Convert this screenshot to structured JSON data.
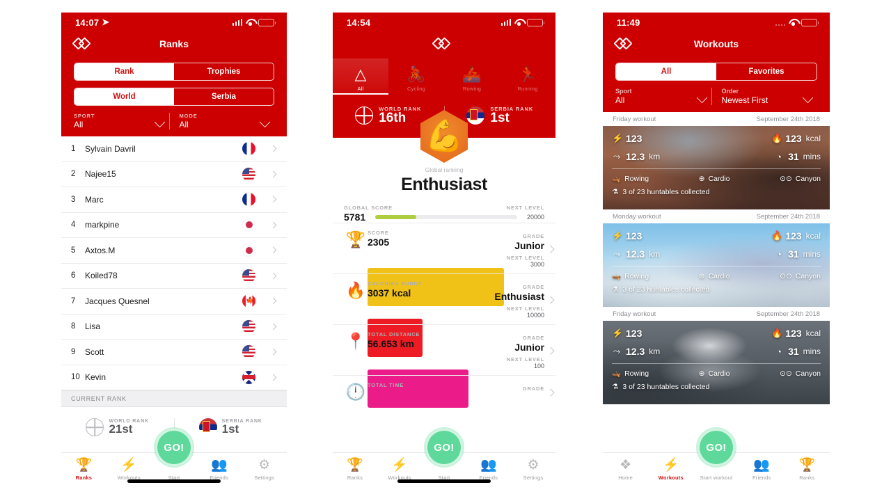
{
  "colors": {
    "brand_red": "#cc0000",
    "accent_red": "#d81111",
    "go_green": "#5fd99b",
    "score_green": "#aece3f",
    "trophy_yellow": "#f0c117",
    "calories_red": "#ed1c24",
    "distance_pink": "#ec1b8a",
    "time_orange": "#f07c1c"
  },
  "screen1": {
    "status": {
      "time": "14:07",
      "location_arrow": "➤",
      "battery": "green"
    },
    "header": {
      "logo": "app-logo",
      "title": "Ranks"
    },
    "segment_type": {
      "options": [
        "Rank",
        "Trophies"
      ],
      "selected": "Rank"
    },
    "segment_scope": {
      "options": [
        "World",
        "Serbia"
      ],
      "selected": "World"
    },
    "filters": [
      {
        "label": "SPORT",
        "value": "All"
      },
      {
        "label": "MODE",
        "value": "All"
      }
    ],
    "rank_rows": [
      {
        "pos": "1",
        "name": "Sylvain Davril",
        "flag": "fr"
      },
      {
        "pos": "2",
        "name": "Najee15",
        "flag": "us"
      },
      {
        "pos": "3",
        "name": "Marc",
        "flag": "fr"
      },
      {
        "pos": "4",
        "name": "markpine",
        "flag": "jp"
      },
      {
        "pos": "5",
        "name": "Axtos.M",
        "flag": "jp"
      },
      {
        "pos": "6",
        "name": "Koiled78",
        "flag": "us"
      },
      {
        "pos": "7",
        "name": "Jacques Quesnel",
        "flag": "ca"
      },
      {
        "pos": "8",
        "name": "Lisa",
        "flag": "us"
      },
      {
        "pos": "9",
        "name": "Scott",
        "flag": "us"
      },
      {
        "pos": "10",
        "name": "Kevin",
        "flag": "gb"
      }
    ],
    "current_rank_header": "CURRENT RANK",
    "current_rank": [
      {
        "label": "WORLD RANK",
        "value": "21st",
        "icon": "globe-icon"
      },
      {
        "label": "SERBIA RANK",
        "value": "1st",
        "icon": "serbia-flag-icon"
      }
    ],
    "tabs": [
      {
        "label": "Ranks",
        "icon": "trophy-icon",
        "active": true
      },
      {
        "label": "Workouts",
        "icon": "bolt-circle-icon",
        "active": false
      },
      {
        "label": "Start",
        "icon": "go-icon",
        "active": false
      },
      {
        "label": "Friends",
        "icon": "friends-icon",
        "active": false
      },
      {
        "label": "Settings",
        "icon": "gear-icon",
        "active": false
      }
    ],
    "go_label": "GO!"
  },
  "screen2": {
    "status": {
      "time": "14:54",
      "battery": "white"
    },
    "header": {
      "logo": "app-logo"
    },
    "sports": [
      {
        "label": "All",
        "icon": "all-sports-icon",
        "active": true
      },
      {
        "label": "Cycling",
        "icon": "cycling-icon",
        "active": false
      },
      {
        "label": "Rowing",
        "icon": "rowing-icon",
        "active": false
      },
      {
        "label": "Running",
        "icon": "running-icon",
        "active": false
      }
    ],
    "ranks": [
      {
        "label": "WORLD RANK",
        "value": "16th",
        "icon": "globe-icon"
      },
      {
        "label": "SERBIA RANK",
        "value": "1st",
        "icon": "serbia-flag-icon"
      }
    ],
    "badge": {
      "icon": "thumbs-up-avatar-icon",
      "subtitle": "Global ranking",
      "title": "Enthusiast"
    },
    "global_score": {
      "label": "GLOBAL SCORE",
      "value": "5781",
      "next_label": "NEXT LEVEL",
      "next_value": "20000",
      "progress": 29
    },
    "stats": [
      {
        "icon": "trophy-icon",
        "label": "SCORE",
        "value": "2305",
        "grade_label": "GRADE",
        "grade": "Junior",
        "next_label": "NEXT LEVEL",
        "next_value": "3000",
        "progress": 77,
        "color": "#f0c117"
      },
      {
        "icon": "flame-icon",
        "label": "CALORIES BURNT",
        "value": "3037 kcal",
        "grade_label": "GRADE",
        "grade": "Enthusiast",
        "next_label": "NEXT LEVEL",
        "next_value": "10000",
        "progress": 31,
        "color": "#ed1c24"
      },
      {
        "icon": "distance-icon",
        "label": "TOTAL DISTANCE",
        "value": "56.653 km",
        "grade_label": "GRADE",
        "grade": "Junior",
        "next_label": "NEXT LEVEL",
        "next_value": "100",
        "progress": 57,
        "color": "#ec1b8a"
      },
      {
        "icon": "clock-icon",
        "label": "TOTAL TIME",
        "value": "",
        "grade_label": "GRADE",
        "grade": "",
        "next_label": "",
        "next_value": "",
        "progress": 0,
        "color": "#f07c1c"
      }
    ],
    "tabs": [
      {
        "label": "Ranks",
        "icon": "trophy-icon",
        "active": false
      },
      {
        "label": "Workouts",
        "icon": "bolt-circle-icon",
        "active": false
      },
      {
        "label": "Start",
        "icon": "go-icon",
        "active": false
      },
      {
        "label": "Friends",
        "icon": "friends-icon",
        "active": false
      },
      {
        "label": "Settings",
        "icon": "gear-icon",
        "active": false
      }
    ],
    "go_label": "GO!"
  },
  "screen3": {
    "status": {
      "time": "11:49",
      "battery": "yellow"
    },
    "header": {
      "logo": "app-logo",
      "title": "Workouts"
    },
    "segment": {
      "options": [
        "All",
        "Favorites"
      ],
      "selected": "All"
    },
    "filters": [
      {
        "label": "Sport",
        "value": "All"
      },
      {
        "label": "Order",
        "value": "Newest First"
      }
    ],
    "workouts": [
      {
        "title": "Friday workout",
        "date": "September 24th 2018",
        "scene": "canyon",
        "power": "123",
        "calories": "123",
        "calories_unit": "kcal",
        "distance": "12.3",
        "distance_unit": "km",
        "duration": "31",
        "duration_unit": "mins",
        "sport": "Rowing",
        "mode": "Cardio",
        "track": "Canyon",
        "huntables": "3 of 23 huntables collected"
      },
      {
        "title": "Monday workout",
        "date": "September 24th 2018",
        "scene": "ice",
        "power": "123",
        "calories": "123",
        "calories_unit": "kcal",
        "distance": "12.3",
        "distance_unit": "km",
        "duration": "31",
        "duration_unit": "mins",
        "sport": "Rowing",
        "mode": "Cardio",
        "track": "Canyon",
        "huntables": "3 of 23 huntables collected"
      },
      {
        "title": "Friday workout",
        "date": "September 24th 2018",
        "scene": "geyser",
        "power": "123",
        "calories": "123",
        "calories_unit": "kcal",
        "distance": "12.3",
        "distance_unit": "km",
        "duration": "31",
        "duration_unit": "mins",
        "sport": "Rowing",
        "mode": "Cardio",
        "track": "Canyon",
        "huntables": "3 of 23 huntables collected"
      }
    ],
    "tabs": [
      {
        "label": "Home",
        "icon": "app-logo-icon",
        "active": false
      },
      {
        "label": "Workouts",
        "icon": "bolt-circle-icon",
        "active": true
      },
      {
        "label": "Start workout",
        "icon": "go-icon",
        "active": false
      },
      {
        "label": "Friends",
        "icon": "friends-icon",
        "active": false
      },
      {
        "label": "Ranks",
        "icon": "trophy-icon",
        "active": false
      }
    ],
    "go_label": "GO!"
  }
}
